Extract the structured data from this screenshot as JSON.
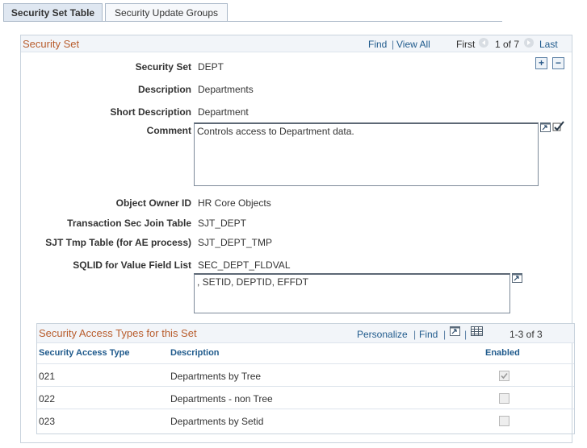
{
  "tabs": [
    {
      "label": "Security Set Table",
      "active": true
    },
    {
      "label": "Security Update Groups",
      "active": false
    }
  ],
  "section": {
    "title": "Security Set",
    "find": "Find",
    "view_all": "View All",
    "first": "First",
    "page_info": "1 of 7",
    "last": "Last",
    "separator": "|"
  },
  "fields": {
    "security_set": {
      "label": "Security Set",
      "value": "DEPT"
    },
    "description": {
      "label": "Description",
      "value": "Departments"
    },
    "short_description": {
      "label": "Short Description",
      "value": "Department"
    },
    "comment": {
      "label": "Comment",
      "value": "Controls access to Department data."
    },
    "object_owner_id": {
      "label": "Object Owner ID",
      "value": "HR Core Objects"
    },
    "transaction_sec_join_table": {
      "label": "Transaction Sec Join Table",
      "value": "SJT_DEPT"
    },
    "sjt_tmp_table": {
      "label": "SJT Tmp Table (for AE process)",
      "value": "SJT_DEPT_TMP"
    },
    "sqlid": {
      "label": "SQLID for Value Field List",
      "value": "SEC_DEPT_FLDVAL"
    },
    "sql_text": ", SETID, DEPTID, EFFDT"
  },
  "grid": {
    "title": "Security Access Types for this Set",
    "personalize": "Personalize",
    "find": "Find",
    "count": "1-3 of 3",
    "columns": [
      "Security Access Type",
      "Description",
      "Enabled"
    ],
    "rows": [
      {
        "type": "021",
        "description": "Departments by Tree",
        "enabled": true
      },
      {
        "type": "022",
        "description": "Departments - non Tree",
        "enabled": false
      },
      {
        "type": "023",
        "description": "Departments by Setid",
        "enabled": false
      }
    ]
  },
  "colors": {
    "section_title": "#b85c2c",
    "link": "#1f5a8c",
    "tab_active_bg": "#dfe7f1"
  }
}
